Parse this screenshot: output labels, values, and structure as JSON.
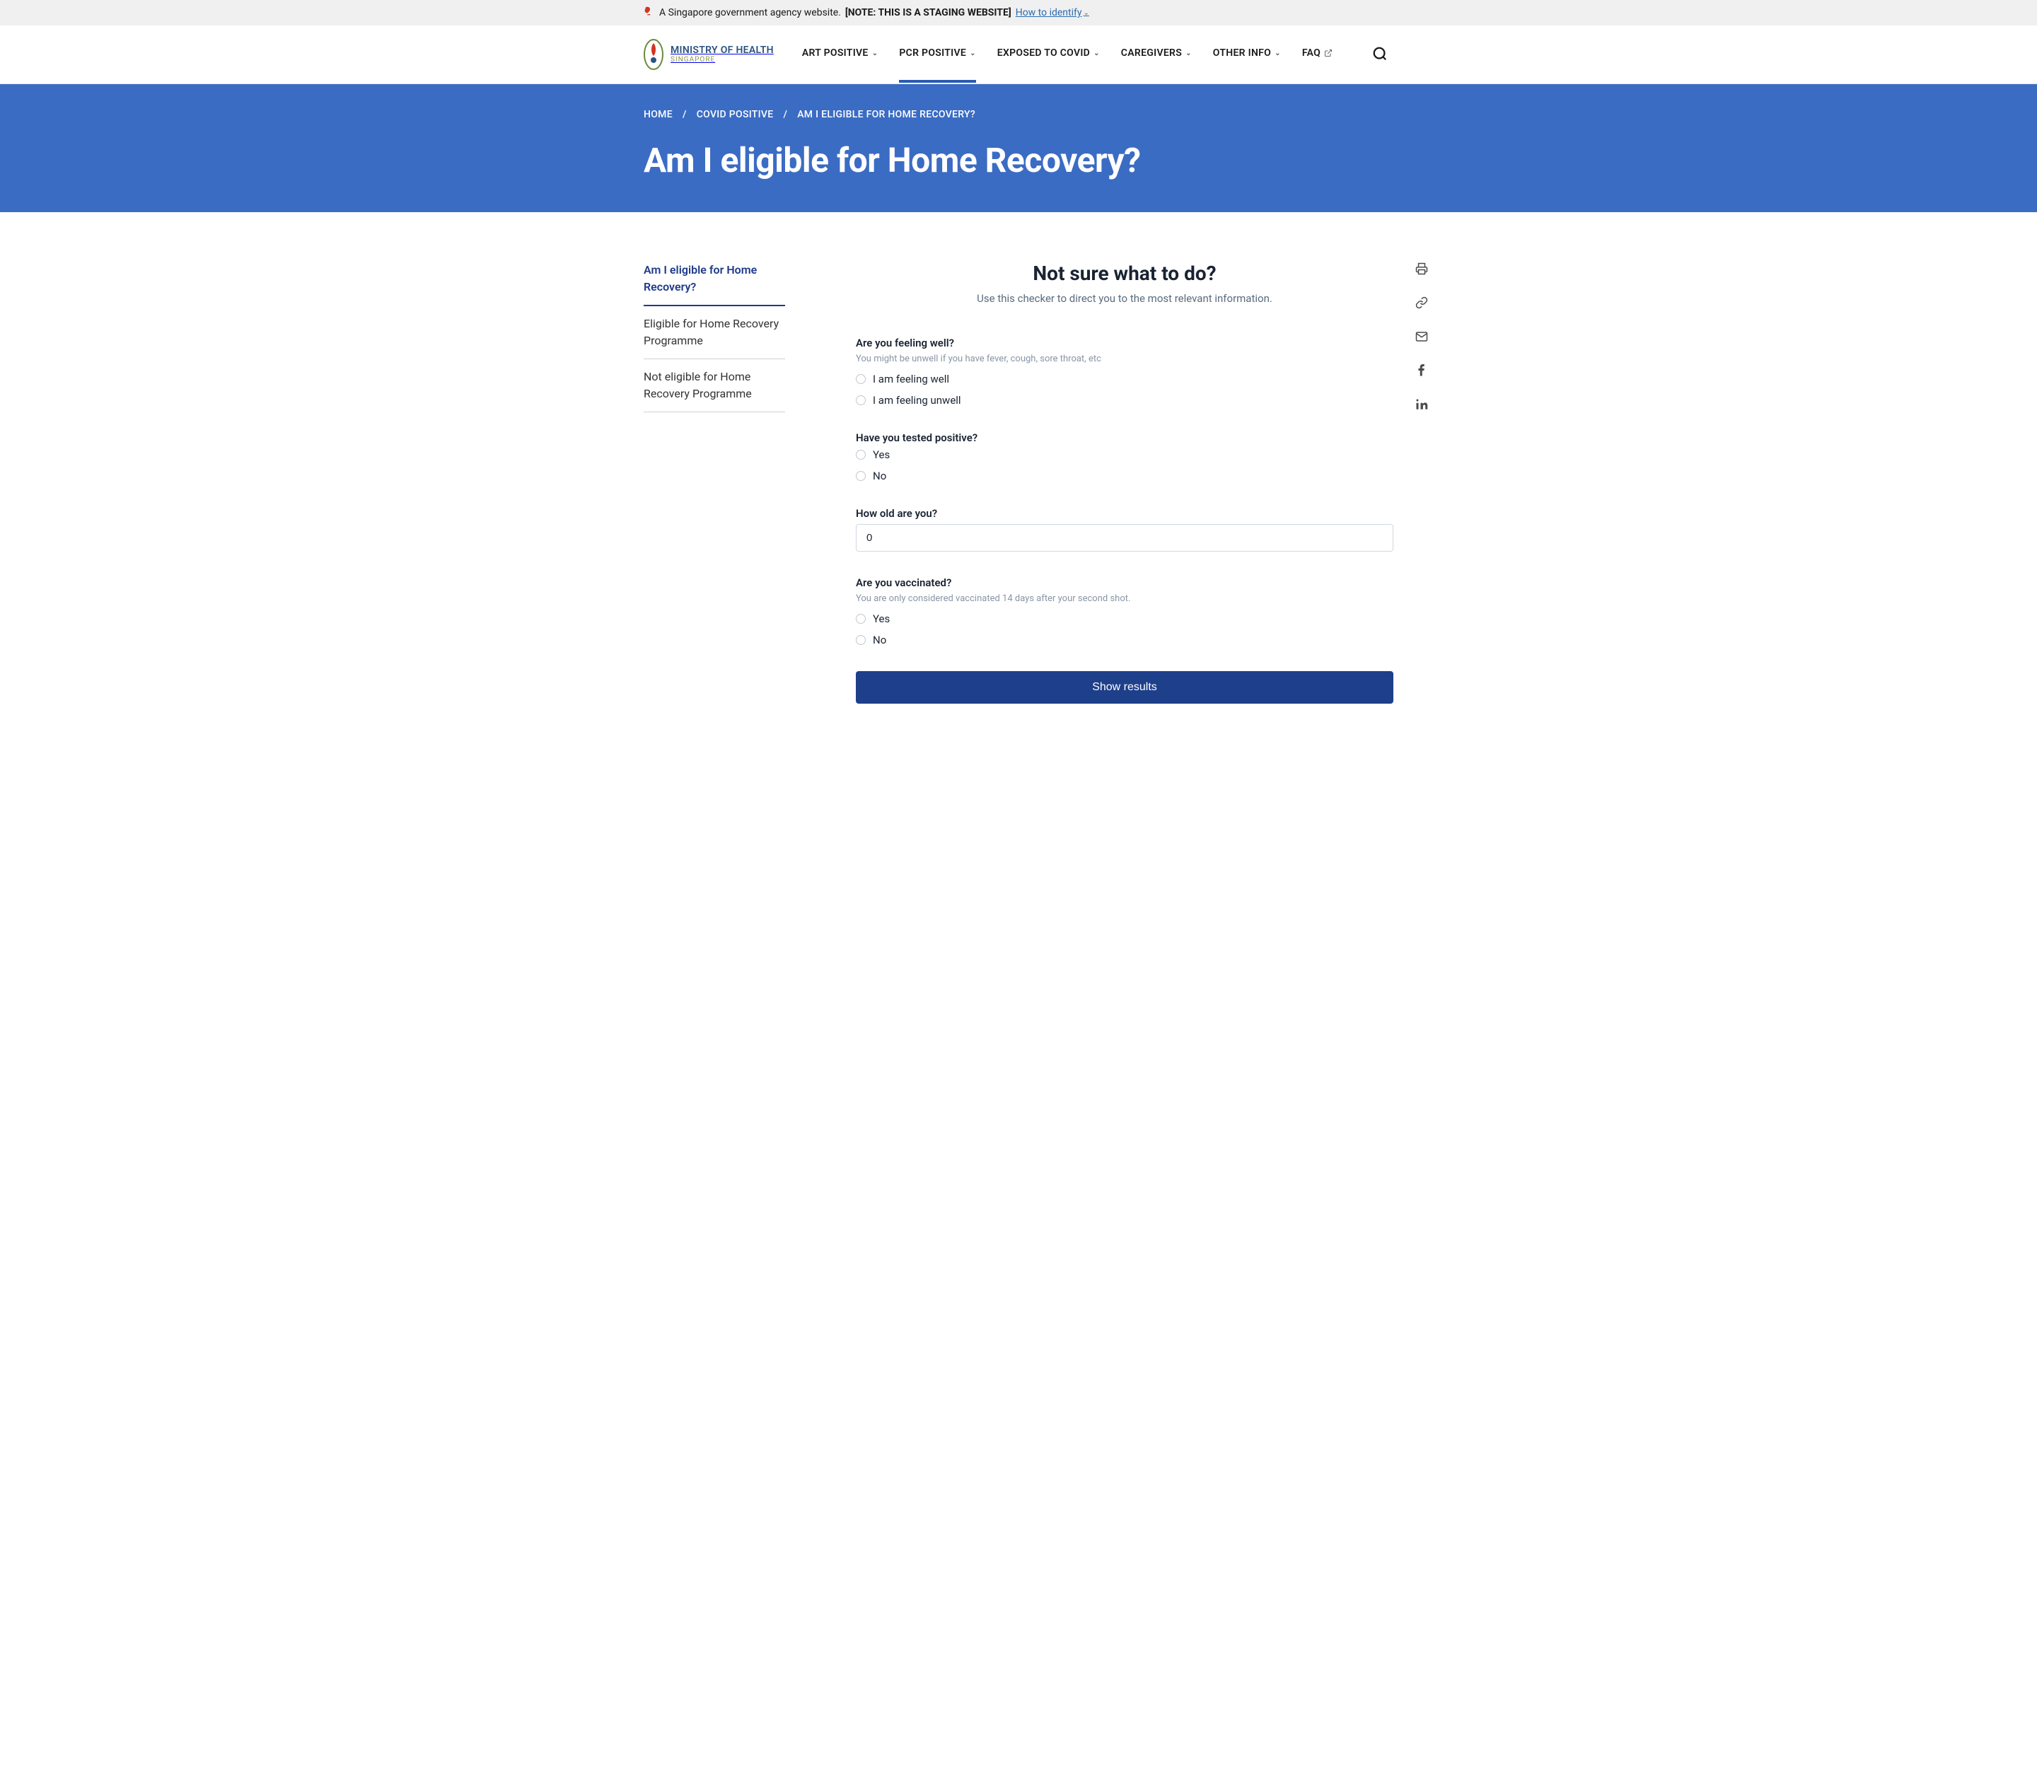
{
  "gov_banner": {
    "text": "A Singapore government agency website.",
    "note": "[NOTE: THIS IS A STAGING WEBSITE]",
    "identify": "How to identify"
  },
  "logo": {
    "title": "MINISTRY OF HEALTH",
    "sub": "SINGAPORE"
  },
  "nav": {
    "art_positive": "ART POSITIVE",
    "pcr_positive": "PCR POSITIVE",
    "exposed": "EXPOSED TO COVID",
    "caregivers": "CAREGIVERS",
    "other_info": "OTHER INFO",
    "faq": "FAQ"
  },
  "breadcrumb": {
    "home": "HOME",
    "covid_positive": "COVID POSITIVE",
    "current": "AM I ELIGIBLE FOR HOME RECOVERY?"
  },
  "hero_title": "Am I eligible for Home Recovery?",
  "sidebar": {
    "items": [
      "Am I eligible for Home Recovery?",
      "Eligible for Home Recovery Programme",
      "Not eligible for Home Recovery Programme"
    ]
  },
  "checker": {
    "title": "Not sure what to do?",
    "sub": "Use this checker to direct you to the most relevant information.",
    "q1": {
      "label": "Are you feeling well?",
      "hint": "You might be unwell if you have fever, cough, sore throat, etc",
      "opt1": "I am feeling well",
      "opt2": "I am feeling unwell"
    },
    "q2": {
      "label": "Have you tested positive?",
      "opt1": "Yes",
      "opt2": "No"
    },
    "q3": {
      "label": "How old are you?",
      "value": "0"
    },
    "q4": {
      "label": "Are you vaccinated?",
      "hint": "You are only considered vaccinated 14 days after your second shot.",
      "opt1": "Yes",
      "opt2": "No"
    },
    "submit": "Show results"
  }
}
